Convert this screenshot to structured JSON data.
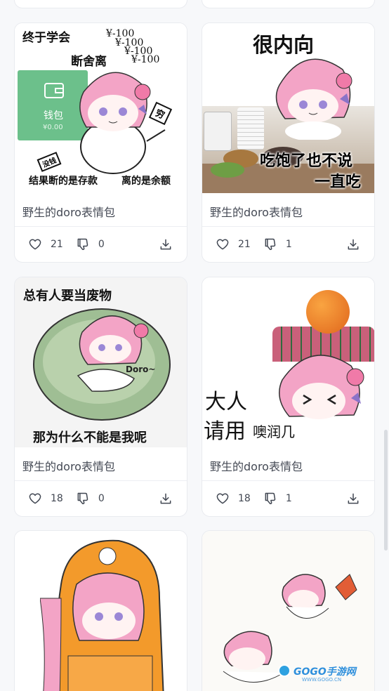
{
  "cards": [
    {
      "title": "野生的doro表情包",
      "likes": "21",
      "dislikes": "0",
      "meme": {
        "line1": "终于学会",
        "line2": "断舍离",
        "amounts": [
          "¥-100",
          "¥-100",
          "¥-100",
          "¥-100"
        ],
        "wallet_label": "钱包",
        "wallet_amount": "¥0.00",
        "bottom_left": "结果断的是存款",
        "bottom_right": "离的是余额",
        "tag_a": "没钱",
        "tag_b": "穷"
      }
    },
    {
      "title": "野生的doro表情包",
      "likes": "21",
      "dislikes": "1",
      "meme": {
        "top": "很内向",
        "bottom1": "吃饱了也不说",
        "bottom2": "一直吃"
      }
    },
    {
      "title": "野生的doro表情包",
      "likes": "18",
      "dislikes": "0",
      "meme": {
        "top": "总有人要当废物",
        "bag_label": "Doro~",
        "bottom": "那为什么不能是我呢"
      }
    },
    {
      "title": "野生的doro表情包",
      "likes": "18",
      "dislikes": "1",
      "meme": {
        "line1": "大人",
        "line2": "请用",
        "line2b": "噢润几"
      }
    },
    {
      "title": "",
      "meme": {}
    },
    {
      "title": "",
      "meme": {
        "watermark_brand": "GOGO手游网",
        "watermark_url": "WWW.GOGO.CN"
      }
    }
  ],
  "colors": {
    "doro_pink": "#f3a4c6",
    "wallet_green": "#6cc08b",
    "bag_green": "#9fbe94",
    "orange_hood": "#f39a2b"
  }
}
